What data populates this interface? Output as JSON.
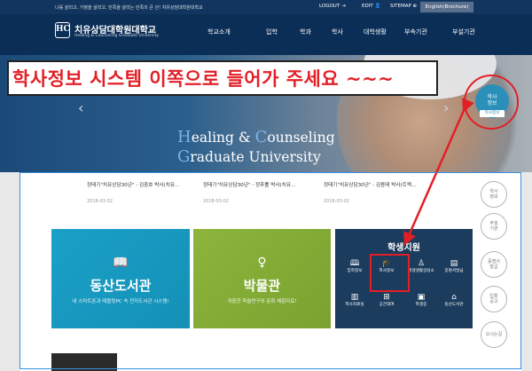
{
  "topbar": {
    "motto": "나를 살리고, 가정을 살리고, 민족을 살리는 민족의 큰 산! 치유상담대학원대학교",
    "logout": "LOGOUT",
    "edit": "EDIT",
    "sitemap": "SITEMAP",
    "english": "English(Brochure)"
  },
  "header": {
    "logo_mark": "HC",
    "logo_kr": "치유상담대학원대학교",
    "logo_en": "Healing & Counseling Graduate University",
    "nav": [
      "학교소개",
      "입학",
      "학과",
      "학사",
      "대학생활",
      "부속기관",
      "부설기관"
    ]
  },
  "hero": {
    "line1_cap1": "H",
    "line1_rest1": "ealing & ",
    "line1_cap2": "C",
    "line1_rest2": "ounseling",
    "line2_cap": "G",
    "line2_rest": "raduate University"
  },
  "annotation": {
    "text": "학사정보 시스템 이쪽으로 들어가 주세요 ~~~"
  },
  "news": [
    {
      "title": "정태기\"치유상담30년\" - 김중호 박사(치유…",
      "date": "2018-03-02"
    },
    {
      "title": "정태기\"치유상담30년\" - 정후률 박사(치유…",
      "date": "2018-03-02"
    },
    {
      "title": "정태기\"치유상담30년\" - 김용태 박사(트랙…",
      "date": "2018-03-02"
    }
  ],
  "library": {
    "title": "동산도서관",
    "sub": "내 스마트폰과 태블릿PC 속 전자도서관 시스템!"
  },
  "museum": {
    "title": "박물관",
    "sub": "귀중한 학술연구와 문화 체험자료!"
  },
  "support": {
    "title": "학생지원",
    "items": [
      {
        "label": "입학정보",
        "icon": "book-icon"
      },
      {
        "label": "학사정보",
        "icon": "graduation-cap-icon"
      },
      {
        "label": "학생생활상담소",
        "icon": "person-icon"
      },
      {
        "label": "증명서발급",
        "icon": "certificate-icon"
      },
      {
        "label": "학사자료실",
        "icon": "archive-icon"
      },
      {
        "label": "공간대여",
        "icon": "grid-icon"
      },
      {
        "label": "학생증",
        "icon": "id-card-icon"
      },
      {
        "label": "동산도서관",
        "icon": "library-icon"
      }
    ]
  },
  "quick": {
    "label_line1": "학사",
    "label_line2": "정보",
    "tag": "학사정보"
  },
  "side_buttons": [
    {
      "line1": "학사",
      "line2": "정보"
    },
    {
      "line1": "부설",
      "line2": "기관"
    },
    {
      "line1": "증명서",
      "line2": "발급"
    },
    {
      "line1": "입찰",
      "line2": "공고"
    },
    {
      "line1": "오시는길",
      "line2": ""
    }
  ],
  "colors": {
    "navy": "#0b2e57",
    "annotation_red": "#e31f26",
    "library_blue": "#1aa0c8",
    "museum_green": "#8cb53d",
    "support_navy": "#1c3c5e"
  }
}
